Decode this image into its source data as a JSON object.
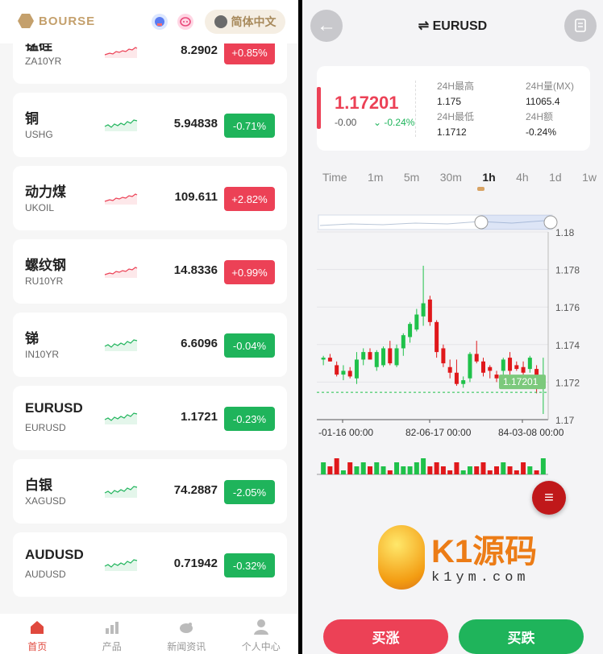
{
  "left": {
    "brand": "BOURSE",
    "lang_label": "简体中文",
    "items": [
      {
        "name": "锰硅",
        "symbol": "ZA10YR",
        "price": "8.2902",
        "change": "+0.85%",
        "dir": "up"
      },
      {
        "name": "铜",
        "symbol": "USHG",
        "price": "5.94838",
        "change": "-0.71%",
        "dir": "down"
      },
      {
        "name": "动力煤",
        "symbol": "UKOIL",
        "price": "109.611",
        "change": "+2.82%",
        "dir": "up"
      },
      {
        "name": "螺纹钢",
        "symbol": "RU10YR",
        "price": "14.8336",
        "change": "+0.99%",
        "dir": "up"
      },
      {
        "name": "锑",
        "symbol": "IN10YR",
        "price": "6.6096",
        "change": "-0.04%",
        "dir": "down"
      },
      {
        "name": "EURUSD",
        "symbol": "EURUSD",
        "price": "1.1721",
        "change": "-0.23%",
        "dir": "down"
      },
      {
        "name": "白银",
        "symbol": "XAGUSD",
        "price": "74.2887",
        "change": "-2.05%",
        "dir": "down"
      },
      {
        "name": "AUDUSD",
        "symbol": "AUDUSD",
        "price": "0.71942",
        "change": "-0.32%",
        "dir": "down"
      }
    ],
    "tabs": [
      {
        "label": "首页",
        "icon": "home-icon"
      },
      {
        "label": "产品",
        "icon": "chart-bars-icon"
      },
      {
        "label": "新闻资讯",
        "icon": "piggy-bank-icon"
      },
      {
        "label": "个人中心",
        "icon": "user-icon"
      }
    ]
  },
  "right": {
    "title": "⇌ EURUSD",
    "price": "1.17201",
    "change": "-0.00",
    "change_pct": "-0.24%",
    "stats": {
      "high_label": "24H最高",
      "high": "1.175",
      "vol_label": "24H量(MX)",
      "vol": "11065.4",
      "low_label": "24H最低",
      "low": "1.1712",
      "amt_label": "24H额",
      "amt": "-0.24%"
    },
    "intervals": [
      "Time",
      "1m",
      "5m",
      "30m",
      "1h",
      "4h",
      "1d",
      "1w"
    ],
    "active_interval": "1h",
    "buy_up": "买涨",
    "buy_down": "买跌",
    "watermark": "K1源码",
    "watermark_sub": "k1ym.com"
  },
  "chart_data": {
    "type": "candlestick",
    "y_ticks": [
      "1.18",
      "1.178",
      "1.176",
      "1.174",
      "1.172",
      "1.17"
    ],
    "x_ticks": [
      "-01-16 00:00",
      "82-06-17 00:00",
      "84-03-08 00:00"
    ],
    "last_price_label": "1.17201",
    "ylim": [
      1.17,
      1.18
    ],
    "candles": [
      [
        1.1732,
        1.1734,
        1.1729,
        1.1733
      ],
      [
        1.1733,
        1.1735,
        1.1731,
        1.1731
      ],
      [
        1.1729,
        1.1731,
        1.1723,
        1.1724
      ],
      [
        1.1724,
        1.1729,
        1.1721,
        1.1726
      ],
      [
        1.1726,
        1.1728,
        1.1722,
        1.1723
      ],
      [
        1.1722,
        1.1736,
        1.1719,
        1.1732
      ],
      [
        1.1732,
        1.1738,
        1.1729,
        1.1736
      ],
      [
        1.1736,
        1.1738,
        1.1732,
        1.1732
      ],
      [
        1.1728,
        1.1737,
        1.1726,
        1.1736
      ],
      [
        1.1729,
        1.1739,
        1.1728,
        1.1738
      ],
      [
        1.1738,
        1.1742,
        1.1729,
        1.173
      ],
      [
        1.1729,
        1.174,
        1.1728,
        1.1738
      ],
      [
        1.1738,
        1.1746,
        1.1734,
        1.1745
      ],
      [
        1.1744,
        1.1752,
        1.1741,
        1.1751
      ],
      [
        1.1748,
        1.1759,
        1.1747,
        1.1756
      ],
      [
        1.1755,
        1.1782,
        1.175,
        1.1762
      ],
      [
        1.1764,
        1.1766,
        1.175,
        1.1752
      ],
      [
        1.1752,
        1.1753,
        1.1733,
        1.1736
      ],
      [
        1.1738,
        1.174,
        1.1728,
        1.173
      ],
      [
        1.1728,
        1.1732,
        1.1722,
        1.1725
      ],
      [
        1.1725,
        1.1732,
        1.1718,
        1.1719
      ],
      [
        1.1719,
        1.1723,
        1.1717,
        1.1721
      ],
      [
        1.1722,
        1.1736,
        1.172,
        1.1735
      ],
      [
        1.1735,
        1.1742,
        1.173,
        1.1731
      ],
      [
        1.1731,
        1.1733,
        1.1723,
        1.1725
      ],
      [
        1.1728,
        1.1729,
        1.1722,
        1.1726
      ],
      [
        1.1724,
        1.1726,
        1.172,
        1.1722
      ],
      [
        1.1726,
        1.1733,
        1.1722,
        1.1732
      ],
      [
        1.1733,
        1.1736,
        1.1724,
        1.1726
      ],
      [
        1.1729,
        1.1731,
        1.1726,
        1.1727
      ],
      [
        1.1728,
        1.1731,
        1.1724,
        1.1725
      ],
      [
        1.1727,
        1.1734,
        1.1725,
        1.1733
      ],
      [
        1.1727,
        1.1729,
        1.1714,
        1.1719
      ],
      [
        1.1718,
        1.1733,
        1.1703,
        1.1721
      ]
    ],
    "volumes": [
      3,
      2,
      4,
      1,
      3,
      2,
      3,
      2,
      3,
      2,
      1,
      3,
      2,
      2,
      3,
      4,
      2,
      3,
      2,
      1,
      3,
      1,
      2,
      2,
      3,
      1,
      2,
      3,
      2,
      1,
      3,
      2,
      1,
      4
    ],
    "xlabel": "",
    "ylabel": ""
  }
}
